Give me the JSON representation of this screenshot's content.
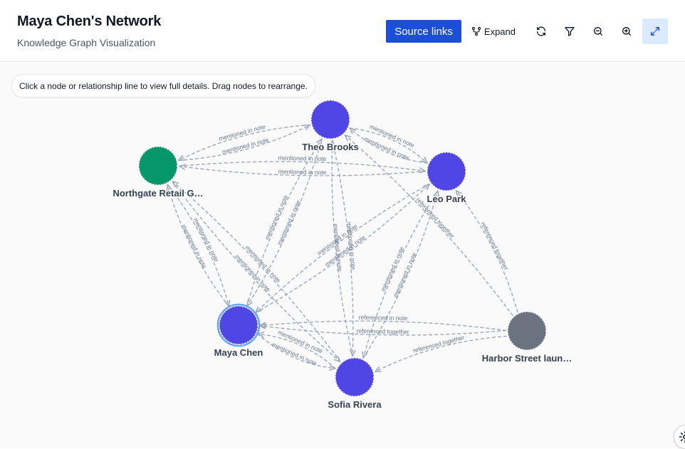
{
  "header": {
    "title": "Maya Chen's Network",
    "subtitle": "Knowledge Graph Visualization"
  },
  "toolbar": {
    "source_links_label": "Source links",
    "expand_label": "Expand",
    "icons": [
      "share-nodes-icon",
      "refresh-icon",
      "filter-icon",
      "zoom-out-icon",
      "zoom-in-icon",
      "fullscreen-icon"
    ]
  },
  "hint": "Click a node or relationship line to view full details. Drag nodes to rearrange.",
  "colors": {
    "primary": "#1d4ed8",
    "person_node": "#4f46e5",
    "organization_node": "#059669",
    "event_node": "#6b7280",
    "edge": "#94a3b8",
    "edge_label": "#64748b"
  },
  "graph": {
    "nodes": [
      {
        "id": "theo",
        "label": "Theo Brooks",
        "type": "person"
      },
      {
        "id": "northgate",
        "label": "Northgate Retail G…",
        "type": "organization"
      },
      {
        "id": "leo",
        "label": "Leo Park",
        "type": "person"
      },
      {
        "id": "maya",
        "label": "Maya Chen",
        "type": "person",
        "selected": true
      },
      {
        "id": "sofia",
        "label": "Sofia Rivera",
        "type": "person"
      },
      {
        "id": "harbor",
        "label": "Harbor Street laun…",
        "type": "event"
      }
    ],
    "edges": [
      {
        "from": "northgate",
        "to": "theo",
        "label": "mentioned in note"
      },
      {
        "from": "theo",
        "to": "northgate",
        "label": "mentioned in note"
      },
      {
        "from": "theo",
        "to": "leo",
        "label": "mentioned in note"
      },
      {
        "from": "leo",
        "to": "theo",
        "label": "mentioned in note"
      },
      {
        "from": "northgate",
        "to": "leo",
        "label": "mentioned in note"
      },
      {
        "from": "leo",
        "to": "northgate",
        "label": "mentioned in note"
      },
      {
        "from": "northgate",
        "to": "maya",
        "label": "mentioned in note"
      },
      {
        "from": "maya",
        "to": "northgate",
        "label": "mentioned in note"
      },
      {
        "from": "northgate",
        "to": "sofia",
        "label": "mentioned in note"
      },
      {
        "from": "sofia",
        "to": "northgate",
        "label": "mentioned in note"
      },
      {
        "from": "theo",
        "to": "maya",
        "label": "mentioned in note"
      },
      {
        "from": "maya",
        "to": "theo",
        "label": "mentioned in note"
      },
      {
        "from": "theo",
        "to": "sofia",
        "label": "mentioned in note"
      },
      {
        "from": "sofia",
        "to": "theo",
        "label": "mentioned in note"
      },
      {
        "from": "leo",
        "to": "maya",
        "label": "mentioned in note"
      },
      {
        "from": "maya",
        "to": "leo",
        "label": "mentioned in note"
      },
      {
        "from": "leo",
        "to": "sofia",
        "label": "mentioned in note"
      },
      {
        "from": "sofia",
        "to": "leo",
        "label": "mentioned in note"
      },
      {
        "from": "maya",
        "to": "sofia",
        "label": "mentioned in note"
      },
      {
        "from": "sofia",
        "to": "maya",
        "label": "mentioned in note"
      },
      {
        "from": "harbor",
        "to": "maya",
        "label": "referenced in note"
      },
      {
        "from": "harbor",
        "to": "maya",
        "label": "referenced together"
      },
      {
        "from": "harbor",
        "to": "sofia",
        "label": "referenced together"
      },
      {
        "from": "harbor",
        "to": "leo",
        "label": "referenced together"
      },
      {
        "from": "harbor",
        "to": "theo",
        "label": "referenced together"
      }
    ]
  }
}
